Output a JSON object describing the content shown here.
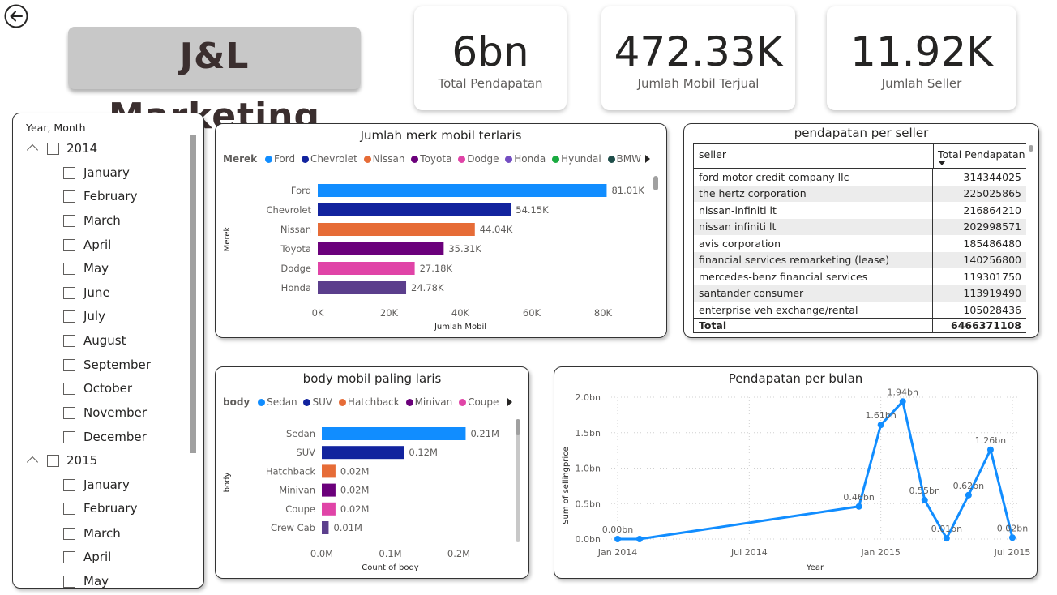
{
  "header": {
    "title": "J&L Marketing",
    "back_icon": "back-arrow-icon"
  },
  "kpis": [
    {
      "value": "6bn",
      "label": "Total Pendapatan"
    },
    {
      "value": "472.33K",
      "label": "Jumlah Mobil Terjual"
    },
    {
      "value": "11.92K",
      "label": "Jumlah Seller"
    }
  ],
  "slicer": {
    "header": "Year, Month",
    "years": [
      {
        "label": "2014",
        "months": [
          "January",
          "February",
          "March",
          "April",
          "May",
          "June",
          "July",
          "August",
          "September",
          "October",
          "November",
          "December"
        ]
      },
      {
        "label": "2015",
        "months": [
          "January",
          "February",
          "March",
          "April",
          "May"
        ]
      }
    ]
  },
  "brand_chart": {
    "title": "Jumlah merk mobil terlaris",
    "legend_title": "Merek",
    "legend": [
      {
        "name": "Ford",
        "color": "#118DFF"
      },
      {
        "name": "Chevrolet",
        "color": "#12239E"
      },
      {
        "name": "Nissan",
        "color": "#E66C37"
      },
      {
        "name": "Toyota",
        "color": "#6B007B"
      },
      {
        "name": "Dodge",
        "color": "#E044A7"
      },
      {
        "name": "Honda",
        "color": "#744EC2"
      },
      {
        "name": "Hyundai",
        "color": "#1AAB40"
      },
      {
        "name": "BMW",
        "color": "#1F4E4A"
      }
    ]
  },
  "body_chart": {
    "title": "body mobil paling laris",
    "legend_title": "body",
    "legend": [
      {
        "name": "Sedan",
        "color": "#118DFF"
      },
      {
        "name": "SUV",
        "color": "#12239E"
      },
      {
        "name": "Hatchback",
        "color": "#E66C37"
      },
      {
        "name": "Minivan",
        "color": "#6B007B"
      },
      {
        "name": "Coupe",
        "color": "#E044A7"
      }
    ]
  },
  "seller_table": {
    "title": "pendapatan per seller",
    "columns": [
      "seller",
      "Total Pendapatan"
    ],
    "rows": [
      [
        "ford motor credit company llc",
        "314344025"
      ],
      [
        "the hertz corporation",
        "225025865"
      ],
      [
        "nissan-infiniti lt",
        "216864210"
      ],
      [
        "nissan infiniti lt",
        "202998571"
      ],
      [
        "avis corporation",
        "185486480"
      ],
      [
        "financial services remarketing (lease)",
        "140256800"
      ],
      [
        "mercedes-benz financial services",
        "119301750"
      ],
      [
        "santander consumer",
        "113919490"
      ],
      [
        "enterprise veh exchange/rental",
        "105028436"
      ]
    ],
    "total_label": "Total",
    "total_value": "6466371108"
  },
  "revenue_chart": {
    "title": "Pendapatan per bulan"
  },
  "chart_data": [
    {
      "type": "bar",
      "title": "Jumlah merk mobil terlaris",
      "orientation": "horizontal",
      "categories": [
        "Ford",
        "Chevrolet",
        "Nissan",
        "Toyota",
        "Dodge",
        "Honda"
      ],
      "values": [
        81010,
        54150,
        44040,
        35310,
        27180,
        24780
      ],
      "data_labels": [
        "81.01K",
        "54.15K",
        "44.04K",
        "35.31K",
        "27.18K",
        "24.78K"
      ],
      "colors": [
        "#118DFF",
        "#12239E",
        "#E66C37",
        "#6B007B",
        "#E044A7",
        "#5B3E8C"
      ],
      "xlabel": "Jumlah Mobil",
      "ylabel": "Merek",
      "xlim": [
        0,
        80000
      ],
      "xticks": [
        "0K",
        "20K",
        "40K",
        "60K",
        "80K"
      ]
    },
    {
      "type": "bar",
      "title": "body mobil paling laris",
      "orientation": "horizontal",
      "categories": [
        "Sedan",
        "SUV",
        "Hatchback",
        "Minivan",
        "Coupe",
        "Crew Cab"
      ],
      "values": [
        0.21,
        0.12,
        0.02,
        0.02,
        0.02,
        0.01
      ],
      "data_labels": [
        "0.21M",
        "0.12M",
        "0.02M",
        "0.02M",
        "0.02M",
        "0.01M"
      ],
      "colors": [
        "#118DFF",
        "#12239E",
        "#E66C37",
        "#6B007B",
        "#E044A7",
        "#5B3E8C"
      ],
      "xlabel": "Count of body",
      "ylabel": "body",
      "xlim": [
        0,
        0.2
      ],
      "xticks": [
        "0.0M",
        "0.1M",
        "0.2M"
      ]
    },
    {
      "type": "line",
      "title": "Pendapatan per bulan",
      "x": [
        "2014-01",
        "2014-02",
        "2014-12",
        "2015-01",
        "2015-02",
        "2015-03",
        "2015-04",
        "2015-05",
        "2015-06",
        "2015-07"
      ],
      "values": [
        0.0,
        0.0,
        0.46,
        1.61,
        1.94,
        0.55,
        0.01,
        0.62,
        1.26,
        0.02
      ],
      "data_labels": [
        "0.00bn",
        "",
        "0.46bn",
        "1.61bn",
        "1.94bn",
        "0.55bn",
        "0.01bn",
        "0.62bn",
        "1.26bn",
        "0.02bn"
      ],
      "color": "#118DFF",
      "xlabel": "Year",
      "ylabel": "Sum of sellingprice",
      "ylim": [
        0,
        2.0
      ],
      "yticks": [
        "0.0bn",
        "0.5bn",
        "1.0bn",
        "1.5bn",
        "2.0bn"
      ],
      "xticks": [
        "Jan 2014",
        "Jul 2014",
        "Jan 2015",
        "Jul 2015"
      ],
      "grid": true
    }
  ]
}
